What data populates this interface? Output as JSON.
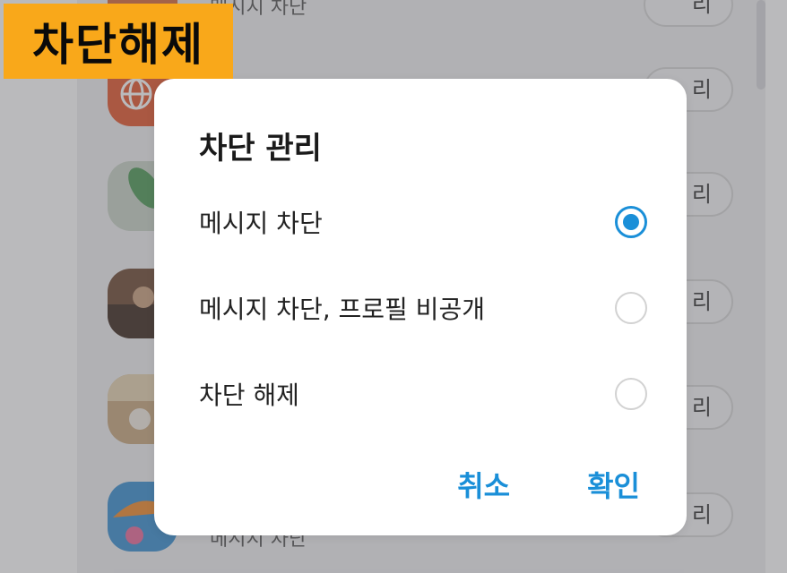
{
  "badge": {
    "text": "차단해제"
  },
  "background": {
    "row_name_text": "메시지 차단",
    "manage_label": "관리",
    "manage_label_visible": "리"
  },
  "dialog": {
    "title": "차단 관리",
    "options": [
      {
        "label": "메시지 차단",
        "selected": true
      },
      {
        "label": "메시지 차단, 프로필 비공개",
        "selected": false
      },
      {
        "label": "차단 해제",
        "selected": false
      }
    ],
    "cancel_label": "취소",
    "confirm_label": "확인"
  },
  "colors": {
    "accent": "#1a8fd8",
    "badge": "#f9a81a"
  }
}
